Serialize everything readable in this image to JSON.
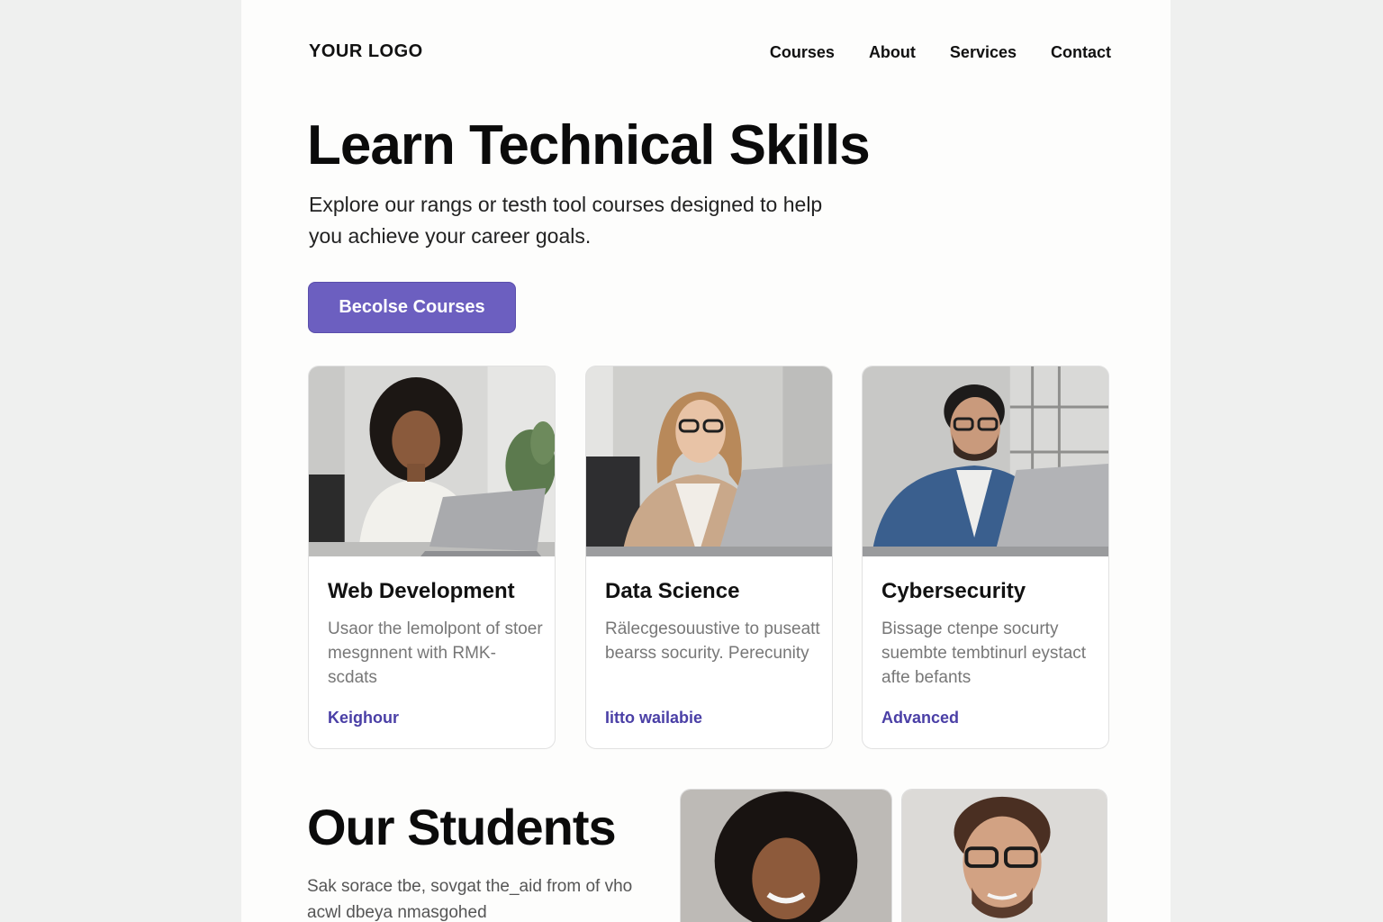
{
  "header": {
    "logo": "YOUR LOGO",
    "nav": [
      "Courses",
      "About",
      "Services",
      "Contact"
    ]
  },
  "hero": {
    "title": "Learn Technical Skills",
    "subtitle": "Explore our rangs or testh tool courses designed to help you achieve your career goals.",
    "cta_label": "Becolse Courses"
  },
  "courses": [
    {
      "title": "Web Development",
      "description": "Usaor the lemolpont of stoer mesgnnent with RMK-scdats",
      "level": "Keighour"
    },
    {
      "title": "Data Science",
      "description": "Rälecgesouustive to puseatt bearss socurity. Perecunity",
      "level": "Iitto wailabie"
    },
    {
      "title": "Cybersecurity",
      "description": "Bissage ctenpe socurty suembte tembtinurl eystact afte befants",
      "level": "Advanced"
    }
  ],
  "students": {
    "title": "Our Students",
    "subtitle": "Sak sorace tbe, sovgat the_aid from of vho acwl dbeya nmasgohed"
  },
  "colors": {
    "accent": "#6c5fc0",
    "level_text": "#4a3fa6",
    "page_bg": "#eff0ef"
  }
}
